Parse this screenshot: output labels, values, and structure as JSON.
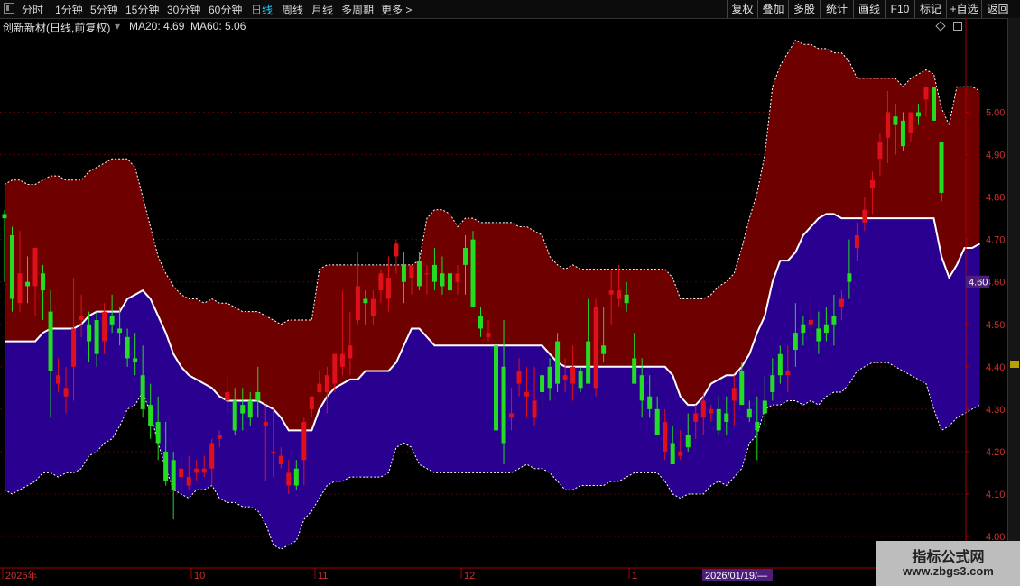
{
  "toolbar": {
    "periods": [
      "分时",
      "1分钟",
      "5分钟",
      "15分钟",
      "30分钟",
      "60分钟",
      "日线",
      "周线",
      "月线",
      "多周期",
      "更多 >"
    ],
    "active_period": "日线",
    "right_buttons": [
      "复权",
      "叠加",
      "多股",
      "统计",
      "画线",
      "F10",
      "标记",
      "+自选",
      "返回"
    ]
  },
  "info": {
    "title": "创新新材(日线,前复权)",
    "ma20": "MA20: 4.69",
    "ma60": "MA60: 5.06"
  },
  "watermark": {
    "line1": "指标公式网",
    "line2": "www.zbgs3.com"
  },
  "colors": {
    "up": "#e0101a",
    "down": "#22dd22",
    "upper_band": "#6e0000",
    "lower_band": "#2a0090",
    "midline": "#ffffff",
    "axis": "#b00000",
    "price_tag": "#4a1e7a"
  },
  "chart_data": {
    "type": "candlestick",
    "ylim": [
      4.0,
      5.18
    ],
    "y_ticks": [
      "4.00",
      "4.10",
      "4.20",
      "4.30",
      "4.40",
      "4.50",
      "4.60",
      "4.70",
      "4.80",
      "4.90",
      "5.00"
    ],
    "x_labels": [
      "2025年",
      "10",
      "11",
      "12",
      "1"
    ],
    "current_price_label": "4.60",
    "crosshair_date": "2026/01/19/—",
    "band_upper": [
      4.83,
      4.84,
      4.84,
      4.83,
      4.83,
      4.84,
      4.85,
      4.85,
      4.84,
      4.84,
      4.84,
      4.86,
      4.87,
      4.88,
      4.89,
      4.89,
      4.89,
      4.87,
      4.8,
      4.73,
      4.66,
      4.62,
      4.59,
      4.57,
      4.56,
      4.56,
      4.55,
      4.56,
      4.55,
      4.55,
      4.54,
      4.53,
      4.53,
      4.53,
      4.52,
      4.51,
      4.5,
      4.51,
      4.51,
      4.51,
      4.51,
      4.63,
      4.64,
      4.64,
      4.64,
      4.64,
      4.64,
      4.64,
      4.64,
      4.64,
      4.64,
      4.64,
      4.64,
      4.64,
      4.65,
      4.75,
      4.77,
      4.77,
      4.76,
      4.73,
      4.75,
      4.75,
      4.74,
      4.74,
      4.74,
      4.74,
      4.74,
      4.73,
      4.73,
      4.72,
      4.71,
      4.66,
      4.64,
      4.63,
      4.64,
      4.63,
      4.63,
      4.63,
      4.63,
      4.63,
      4.63,
      4.63,
      4.63,
      4.63,
      4.63,
      4.63,
      4.63,
      4.61,
      4.56,
      4.56,
      4.56,
      4.56,
      4.57,
      4.59,
      4.6,
      4.62,
      4.68,
      4.75,
      4.81,
      4.9,
      5.06,
      5.11,
      5.14,
      5.17,
      5.16,
      5.16,
      5.15,
      5.15,
      5.14,
      5.14,
      5.12,
      5.08,
      5.08,
      5.08,
      5.08,
      5.08,
      5.08,
      5.06,
      5.08,
      5.09,
      5.1,
      5.09,
      5.01,
      4.97,
      5.06,
      5.06,
      5.06,
      5.05
    ],
    "band_lower": [
      4.11,
      4.1,
      4.11,
      4.12,
      4.13,
      4.15,
      4.15,
      4.14,
      4.15,
      4.15,
      4.16,
      4.19,
      4.2,
      4.22,
      4.23,
      4.26,
      4.3,
      4.31,
      4.34,
      4.29,
      4.22,
      4.16,
      4.11,
      4.1,
      4.09,
      4.11,
      4.11,
      4.12,
      4.09,
      4.08,
      4.08,
      4.07,
      4.07,
      4.06,
      4.03,
      3.98,
      3.97,
      3.98,
      3.99,
      4.04,
      4.06,
      4.09,
      4.12,
      4.13,
      4.13,
      4.14,
      4.14,
      4.14,
      4.14,
      4.14,
      4.15,
      4.21,
      4.22,
      4.21,
      4.17,
      4.16,
      4.15,
      4.15,
      4.15,
      4.15,
      4.15,
      4.15,
      4.15,
      4.15,
      4.15,
      4.15,
      4.15,
      4.16,
      4.17,
      4.16,
      4.16,
      4.15,
      4.13,
      4.11,
      4.11,
      4.12,
      4.12,
      4.12,
      4.12,
      4.13,
      4.13,
      4.14,
      4.15,
      4.15,
      4.15,
      4.15,
      4.13,
      4.1,
      4.09,
      4.1,
      4.1,
      4.1,
      4.12,
      4.13,
      4.12,
      4.14,
      4.16,
      4.22,
      4.24,
      4.3,
      4.31,
      4.31,
      4.32,
      4.32,
      4.31,
      4.32,
      4.31,
      4.33,
      4.34,
      4.34,
      4.36,
      4.39,
      4.4,
      4.41,
      4.41,
      4.41,
      4.4,
      4.39,
      4.38,
      4.37,
      4.36,
      4.3,
      4.25,
      4.26,
      4.28,
      4.29,
      4.3,
      4.31
    ],
    "band_mid": [
      4.46,
      4.46,
      4.46,
      4.46,
      4.46,
      4.48,
      4.49,
      4.49,
      4.49,
      4.49,
      4.5,
      4.52,
      4.53,
      4.53,
      4.53,
      4.53,
      4.56,
      4.57,
      4.58,
      4.56,
      4.52,
      4.48,
      4.43,
      4.4,
      4.38,
      4.37,
      4.36,
      4.35,
      4.33,
      4.32,
      4.32,
      4.32,
      4.32,
      4.32,
      4.31,
      4.3,
      4.28,
      4.25,
      4.25,
      4.25,
      4.25,
      4.3,
      4.33,
      4.35,
      4.36,
      4.37,
      4.37,
      4.39,
      4.39,
      4.39,
      4.39,
      4.41,
      4.45,
      4.49,
      4.49,
      4.47,
      4.45,
      4.45,
      4.45,
      4.45,
      4.45,
      4.45,
      4.45,
      4.45,
      4.45,
      4.45,
      4.45,
      4.45,
      4.45,
      4.45,
      4.45,
      4.43,
      4.41,
      4.4,
      4.4,
      4.4,
      4.4,
      4.4,
      4.4,
      4.4,
      4.4,
      4.4,
      4.4,
      4.4,
      4.4,
      4.4,
      4.4,
      4.38,
      4.33,
      4.31,
      4.31,
      4.33,
      4.36,
      4.37,
      4.38,
      4.38,
      4.4,
      4.43,
      4.48,
      4.52,
      4.6,
      4.65,
      4.65,
      4.67,
      4.71,
      4.73,
      4.75,
      4.76,
      4.76,
      4.75,
      4.75,
      4.75,
      4.75,
      4.75,
      4.75,
      4.75,
      4.75,
      4.75,
      4.75,
      4.75,
      4.75,
      4.75,
      4.66,
      4.61,
      4.64,
      4.68,
      4.68,
      4.69
    ],
    "ohlc": [
      [
        4.76,
        4.77,
        4.6,
        4.75
      ],
      [
        4.71,
        4.73,
        4.53,
        4.56
      ],
      [
        4.55,
        4.72,
        4.53,
        4.62
      ],
      [
        4.6,
        4.66,
        4.55,
        4.59
      ],
      [
        4.59,
        4.68,
        4.52,
        4.68
      ],
      [
        4.62,
        4.64,
        4.51,
        4.58
      ],
      [
        4.53,
        4.58,
        4.28,
        4.39
      ],
      [
        4.36,
        4.42,
        4.34,
        4.38
      ],
      [
        4.33,
        4.4,
        4.29,
        4.35
      ],
      [
        4.4,
        4.61,
        4.32,
        4.49
      ],
      [
        4.51,
        4.57,
        4.47,
        4.52
      ],
      [
        4.5,
        4.53,
        4.41,
        4.46
      ],
      [
        4.51,
        4.53,
        4.4,
        4.43
      ],
      [
        4.46,
        4.55,
        4.43,
        4.53
      ],
      [
        4.52,
        4.57,
        4.48,
        4.5
      ],
      [
        4.49,
        4.54,
        4.45,
        4.48
      ],
      [
        4.47,
        4.49,
        4.4,
        4.42
      ],
      [
        4.42,
        4.48,
        4.38,
        4.41
      ],
      [
        4.38,
        4.45,
        4.28,
        4.3
      ],
      [
        4.31,
        4.36,
        4.23,
        4.26
      ],
      [
        4.27,
        4.33,
        4.18,
        4.22
      ],
      [
        4.2,
        4.27,
        4.12,
        4.13
      ],
      [
        4.18,
        4.2,
        4.04,
        4.11
      ],
      [
        4.14,
        4.19,
        4.11,
        4.16
      ],
      [
        4.12,
        4.19,
        4.11,
        4.14
      ],
      [
        4.15,
        4.18,
        4.13,
        4.16
      ],
      [
        4.15,
        4.19,
        4.14,
        4.16
      ],
      [
        4.16,
        4.23,
        4.12,
        4.22
      ],
      [
        4.23,
        4.25,
        4.21,
        4.24
      ],
      [
        4.32,
        4.38,
        4.29,
        4.34
      ],
      [
        4.32,
        4.35,
        4.24,
        4.25
      ],
      [
        4.31,
        4.35,
        4.25,
        4.29
      ],
      [
        4.32,
        4.34,
        4.26,
        4.28
      ],
      [
        4.34,
        4.4,
        4.28,
        4.32
      ],
      [
        4.26,
        4.31,
        4.13,
        4.27
      ],
      [
        4.2,
        4.3,
        4.14,
        4.2
      ],
      [
        4.17,
        4.21,
        4.16,
        4.19
      ],
      [
        4.12,
        4.18,
        4.1,
        4.15
      ],
      [
        4.16,
        4.18,
        4.11,
        4.12
      ],
      [
        4.18,
        4.28,
        4.12,
        4.27
      ],
      [
        4.3,
        4.33,
        4.28,
        4.33
      ],
      [
        4.34,
        4.39,
        4.34,
        4.36
      ],
      [
        4.34,
        4.4,
        4.29,
        4.38
      ],
      [
        4.36,
        4.42,
        4.34,
        4.43
      ],
      [
        4.4,
        4.58,
        4.38,
        4.43
      ],
      [
        4.42,
        4.53,
        4.38,
        4.45
      ],
      [
        4.51,
        4.67,
        4.5,
        4.59
      ],
      [
        4.56,
        4.58,
        4.5,
        4.55
      ],
      [
        4.52,
        4.58,
        4.5,
        4.56
      ],
      [
        4.58,
        4.63,
        4.55,
        4.62
      ],
      [
        4.56,
        4.66,
        4.53,
        4.61
      ],
      [
        4.66,
        4.7,
        4.62,
        4.69
      ],
      [
        4.64,
        4.67,
        4.55,
        4.6
      ],
      [
        4.61,
        4.64,
        4.57,
        4.64
      ],
      [
        4.65,
        4.67,
        4.58,
        4.59
      ],
      [
        4.62,
        4.64,
        4.57,
        4.62
      ],
      [
        4.64,
        4.68,
        4.58,
        4.6
      ],
      [
        4.62,
        4.66,
        4.57,
        4.59
      ],
      [
        4.62,
        4.64,
        4.55,
        4.58
      ],
      [
        4.6,
        4.64,
        4.57,
        4.62
      ],
      [
        4.68,
        4.71,
        4.57,
        4.64
      ],
      [
        4.7,
        4.72,
        4.6,
        4.54
      ],
      [
        4.52,
        4.54,
        4.47,
        4.49
      ],
      [
        4.47,
        4.51,
        4.46,
        4.48
      ],
      [
        4.45,
        4.51,
        4.3,
        4.25
      ],
      [
        4.4,
        4.51,
        4.17,
        4.22
      ],
      [
        4.28,
        4.35,
        4.25,
        4.29
      ],
      [
        4.36,
        4.42,
        4.33,
        4.39
      ],
      [
        4.33,
        4.4,
        4.28,
        4.34
      ],
      [
        4.28,
        4.4,
        4.26,
        4.32
      ],
      [
        4.38,
        4.41,
        4.3,
        4.34
      ],
      [
        4.4,
        4.42,
        4.32,
        4.35
      ],
      [
        4.46,
        4.48,
        4.34,
        4.36
      ],
      [
        4.37,
        4.42,
        4.34,
        4.38
      ],
      [
        4.36,
        4.45,
        4.32,
        4.4
      ],
      [
        4.39,
        4.4,
        4.34,
        4.35
      ],
      [
        4.46,
        4.56,
        4.4,
        4.36
      ],
      [
        4.35,
        4.56,
        4.33,
        4.54
      ],
      [
        4.45,
        4.54,
        4.41,
        4.43
      ],
      [
        4.57,
        4.63,
        4.5,
        4.58
      ],
      [
        4.56,
        4.64,
        4.54,
        4.58
      ],
      [
        4.57,
        4.6,
        4.53,
        4.55
      ],
      [
        4.42,
        4.48,
        4.36,
        4.36
      ],
      [
        4.38,
        4.42,
        4.28,
        4.32
      ],
      [
        4.33,
        4.38,
        4.28,
        4.3
      ],
      [
        4.3,
        4.33,
        4.24,
        4.24
      ],
      [
        4.2,
        4.3,
        4.18,
        4.27
      ],
      [
        4.22,
        4.26,
        4.17,
        4.17
      ],
      [
        4.19,
        4.25,
        4.18,
        4.2
      ],
      [
        4.24,
        4.29,
        4.2,
        4.21
      ],
      [
        4.27,
        4.31,
        4.23,
        4.29
      ],
      [
        4.28,
        4.34,
        4.24,
        4.32
      ],
      [
        4.29,
        4.31,
        4.27,
        4.3
      ],
      [
        4.3,
        4.33,
        4.24,
        4.25
      ],
      [
        4.29,
        4.33,
        4.24,
        4.27
      ],
      [
        4.32,
        4.38,
        4.26,
        4.35
      ],
      [
        4.39,
        4.41,
        4.32,
        4.31
      ],
      [
        4.3,
        4.32,
        4.27,
        4.28
      ],
      [
        4.27,
        4.33,
        4.18,
        4.25
      ],
      [
        4.32,
        4.38,
        4.26,
        4.29
      ],
      [
        4.38,
        4.42,
        4.32,
        4.34
      ],
      [
        4.43,
        4.45,
        4.36,
        4.38
      ],
      [
        4.38,
        4.45,
        4.34,
        4.39
      ],
      [
        4.48,
        4.55,
        4.4,
        4.44
      ],
      [
        4.5,
        4.52,
        4.45,
        4.48
      ],
      [
        4.5,
        4.56,
        4.47,
        4.51
      ],
      [
        4.49,
        4.53,
        4.43,
        4.46
      ],
      [
        4.5,
        4.54,
        4.46,
        4.48
      ],
      [
        4.52,
        4.57,
        4.45,
        4.5
      ],
      [
        4.54,
        4.58,
        4.51,
        4.56
      ],
      [
        4.62,
        4.7,
        4.56,
        4.6
      ],
      [
        4.68,
        4.74,
        4.65,
        4.71
      ],
      [
        4.74,
        4.8,
        4.72,
        4.77
      ],
      [
        4.82,
        4.86,
        4.76,
        4.84
      ],
      [
        4.89,
        4.95,
        4.85,
        4.93
      ],
      [
        4.94,
        5.05,
        4.88,
        5.0
      ],
      [
        4.99,
        5.02,
        4.9,
        4.97
      ],
      [
        4.98,
        5.0,
        4.91,
        4.92
      ],
      [
        4.95,
        5.0,
        4.93,
        5.0
      ],
      [
        5.0,
        5.02,
        4.97,
        4.99
      ],
      [
        5.03,
        5.04,
        4.99,
        5.06
      ],
      [
        5.06,
        5.06,
        5.0,
        4.98
      ],
      [
        4.93,
        4.93,
        4.79,
        4.81
      ]
    ]
  }
}
